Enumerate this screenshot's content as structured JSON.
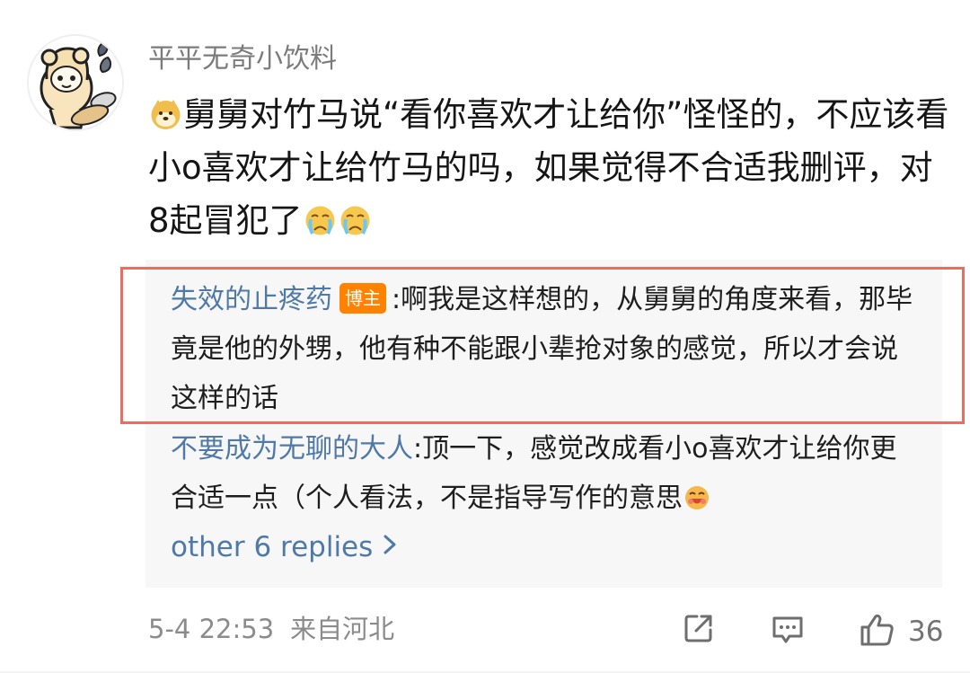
{
  "comment": {
    "username": "平平无奇小饮料",
    "lines": [
      "舅舅对竹马说“看你喜欢才让给你”怪怪的，不应该看",
      "小o喜欢才让给竹马的吗，如果觉得不合适我删评，对",
      "8起冒犯了"
    ],
    "emoji": {
      "leading": "dog-emoji",
      "trailing": [
        "crying-face-icon",
        "crying-face-icon"
      ]
    }
  },
  "replies": [
    {
      "author": "失效的止疼药",
      "badge": "博主",
      "separator": ":",
      "text": "啊我是这样想的，从舅舅的角度来看，那毕竟是他的外甥，他有种不能跟小辈抢对象的感觉，所以才会说这样的话"
    },
    {
      "author": "不要成为无聊的大人",
      "separator": ":",
      "text": "顶一下，感觉改成看小o喜欢才让给你更合适一点（个人看法，不是指导写作的意思",
      "trailing_emoji": "laughing-face-icon"
    }
  ],
  "more_replies": {
    "label": "other 6 replies",
    "icon": "chevron-right-icon"
  },
  "footer": {
    "timestamp": "5-4 22:53",
    "location": "来自河北",
    "like_count": "36",
    "actions": [
      "share-icon",
      "reply-icon",
      "like-icon"
    ]
  },
  "colors": {
    "link": "#4f79a6",
    "badge": "#ff8200",
    "highlight_box": "#eb6d62",
    "reply_background": "#f7f7f7"
  }
}
